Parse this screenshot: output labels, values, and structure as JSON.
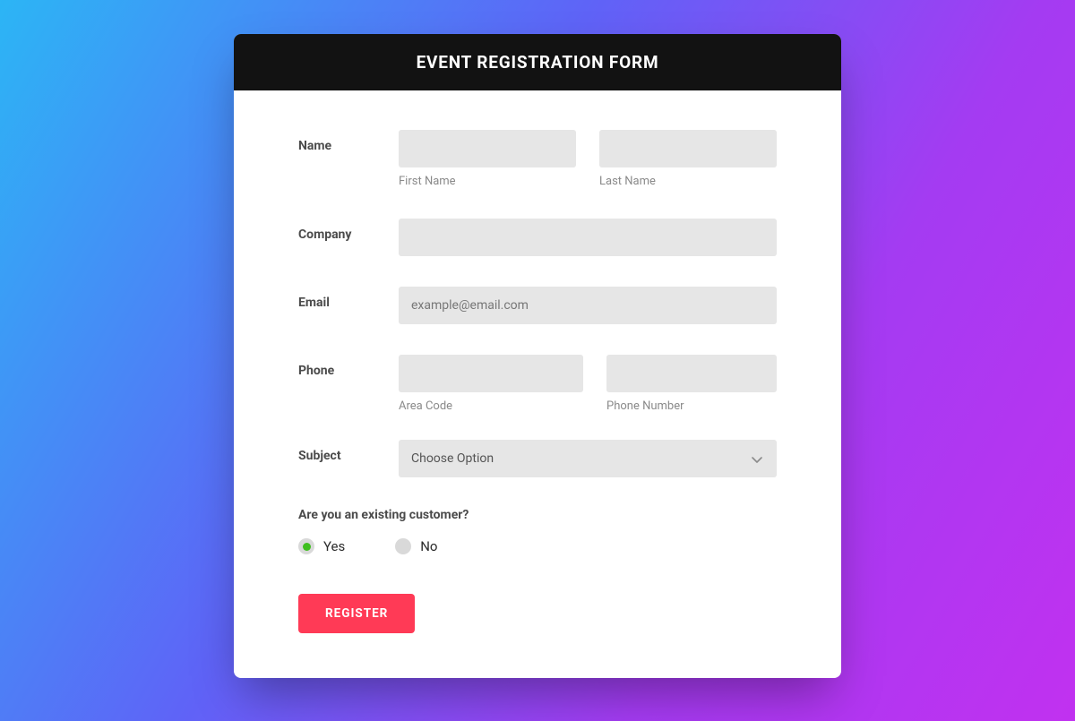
{
  "header": {
    "title": "EVENT REGISTRATION FORM"
  },
  "fields": {
    "name": {
      "label": "Name",
      "first_sublabel": "First Name",
      "last_sublabel": "Last Name",
      "first_value": "",
      "last_value": ""
    },
    "company": {
      "label": "Company",
      "value": ""
    },
    "email": {
      "label": "Email",
      "placeholder": "example@email.com",
      "value": ""
    },
    "phone": {
      "label": "Phone",
      "area_sublabel": "Area Code",
      "number_sublabel": "Phone Number",
      "area_value": "",
      "number_value": ""
    },
    "subject": {
      "label": "Subject",
      "selected": "Choose Option"
    }
  },
  "existing_customer": {
    "question": "Are you an existing customer?",
    "yes_label": "Yes",
    "no_label": "No",
    "value": "yes"
  },
  "submit": {
    "label": "REGISTER"
  }
}
